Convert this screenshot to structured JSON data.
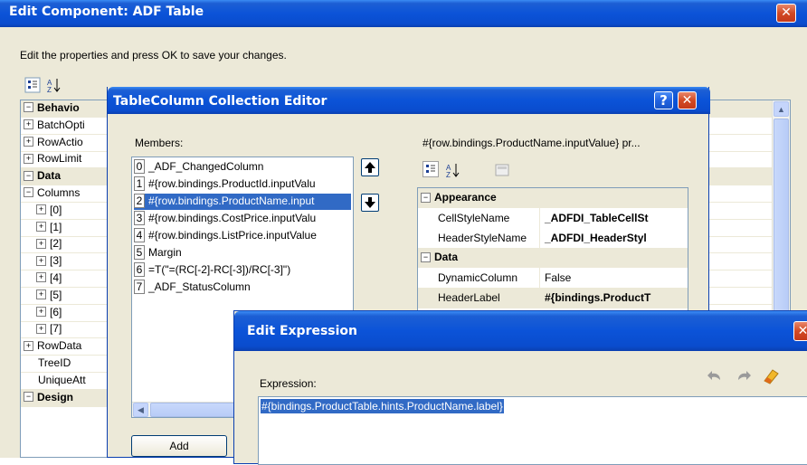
{
  "outer": {
    "title": "Edit Component: ADF Table",
    "instructions": "Edit the properties and press OK to save your changes.",
    "rows": [
      {
        "type": "cat",
        "sign": "⊟",
        "label": "Behavio"
      },
      {
        "type": "prop",
        "sign": "⊞",
        "label": "BatchOpti"
      },
      {
        "type": "prop",
        "sign": "⊞",
        "label": "RowActio"
      },
      {
        "type": "prop",
        "sign": "⊞",
        "label": "RowLimit"
      },
      {
        "type": "cat",
        "sign": "⊟",
        "label": "Data"
      },
      {
        "type": "prop",
        "sign": "⊟",
        "label": "Columns"
      },
      {
        "type": "sub",
        "sign": "⊞",
        "label": "[0]"
      },
      {
        "type": "sub",
        "sign": "⊞",
        "label": "[1]"
      },
      {
        "type": "sub",
        "sign": "⊞",
        "label": "[2]"
      },
      {
        "type": "sub",
        "sign": "⊞",
        "label": "[3]"
      },
      {
        "type": "sub",
        "sign": "⊞",
        "label": "[4]"
      },
      {
        "type": "sub",
        "sign": "⊞",
        "label": "[5]"
      },
      {
        "type": "sub",
        "sign": "⊞",
        "label": "[6]"
      },
      {
        "type": "sub",
        "sign": "⊞",
        "label": "[7]"
      },
      {
        "type": "prop",
        "sign": "⊞",
        "label": "RowData"
      },
      {
        "type": "prop",
        "sign": "",
        "label": "TreeID"
      },
      {
        "type": "prop",
        "sign": "",
        "label": "UniqueAtt"
      },
      {
        "type": "cat",
        "sign": "⊟",
        "label": "Design"
      }
    ]
  },
  "collection": {
    "title": "TableColumn Collection Editor",
    "help": "?",
    "members_label": "Members:",
    "members": [
      {
        "idx": "0",
        "text": "_ADF_ChangedColumn"
      },
      {
        "idx": "1",
        "text": "#{row.bindings.ProductId.inputValu"
      },
      {
        "idx": "2",
        "text": "#{row.bindings.ProductName.input"
      },
      {
        "idx": "3",
        "text": "#{row.bindings.CostPrice.inputValu"
      },
      {
        "idx": "4",
        "text": "#{row.bindings.ListPrice.inputValue"
      },
      {
        "idx": "5",
        "text": "Margin"
      },
      {
        "idx": "6",
        "text": "=T(\"=(RC[-2]-RC[-3])/RC[-3]\")"
      },
      {
        "idx": "7",
        "text": "_ADF_StatusColumn"
      }
    ],
    "add_label": "Add",
    "props_header": "#{row.bindings.ProductName.inputValue} pr...",
    "props": [
      {
        "type": "cat",
        "label": "Appearance",
        "value": ""
      },
      {
        "type": "prop",
        "label": "CellStyleName",
        "value": "_ADFDI_TableCellSt"
      },
      {
        "type": "prop",
        "label": "HeaderStyleName",
        "value": "_ADFDI_HeaderStyl"
      },
      {
        "type": "cat",
        "label": "Data",
        "value": ""
      },
      {
        "type": "prop",
        "label": "DynamicColumn",
        "value": "False"
      },
      {
        "type": "prop",
        "label": "HeaderLabel",
        "value": "#{bindings.ProductT"
      }
    ]
  },
  "expr": {
    "title": "Edit Expression",
    "label": "Expression:",
    "value": "#{bindings.ProductTable.hints.ProductName.label}"
  },
  "icons": {
    "categorized": "categorized-icon",
    "alphabetical": "alphabetical-sort-icon",
    "pages": "property-pages-icon",
    "undo": "undo-icon",
    "redo": "redo-icon",
    "clear": "eraser-icon"
  }
}
